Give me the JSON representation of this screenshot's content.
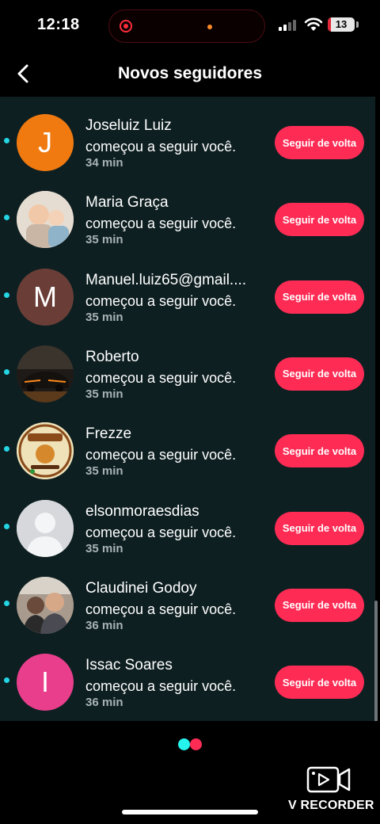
{
  "status_bar": {
    "time": "12:18",
    "battery_percent": "13",
    "battery_level": 0.13
  },
  "header": {
    "title": "Novos seguidores"
  },
  "notifications": [
    {
      "name": "Joseluiz Luiz",
      "action": "começou a seguir você.",
      "time": "34 min",
      "button": "Seguir de volta",
      "avatar_initial": "J",
      "avatar_color": "#f07a10"
    },
    {
      "name": "Maria Graça",
      "action": "começou a seguir você.",
      "time": "35 min",
      "button": "Seguir de volta",
      "avatar_initial": "",
      "avatar_color": "#d8cfc4"
    },
    {
      "name": "Manuel.luiz65@gmail....",
      "action": "começou a seguir você.",
      "time": "35 min",
      "button": "Seguir de volta",
      "avatar_initial": "M",
      "avatar_color": "#6a3e36"
    },
    {
      "name": "Roberto",
      "action": "começou a seguir você.",
      "time": "35 min",
      "button": "Seguir de volta",
      "avatar_initial": "",
      "avatar_color": "#2a2420"
    },
    {
      "name": "Frezze",
      "action": "começou a seguir você.",
      "time": "35 min",
      "button": "Seguir de volta",
      "avatar_initial": "",
      "avatar_color": "#e9d8a8"
    },
    {
      "name": "elsonmoraesdias",
      "action": "começou a seguir você.",
      "time": "35 min",
      "button": "Seguir de volta",
      "avatar_initial": "",
      "avatar_color": "#d4d6da"
    },
    {
      "name": "Claudinei Godoy",
      "action": "começou a seguir você.",
      "time": "36 min",
      "button": "Seguir de volta",
      "avatar_initial": "",
      "avatar_color": "#8a7a6e"
    },
    {
      "name": "Issac Soares",
      "action": "começou a seguir você.",
      "time": "36 min",
      "button": "Seguir de volta",
      "avatar_initial": "I",
      "avatar_color": "#e83e8c"
    }
  ],
  "watermark": {
    "label": "V RECORDER"
  },
  "colors": {
    "accent": "#fe2c55",
    "cyan": "#25f4ee",
    "list_bg": "#0e1f22"
  }
}
